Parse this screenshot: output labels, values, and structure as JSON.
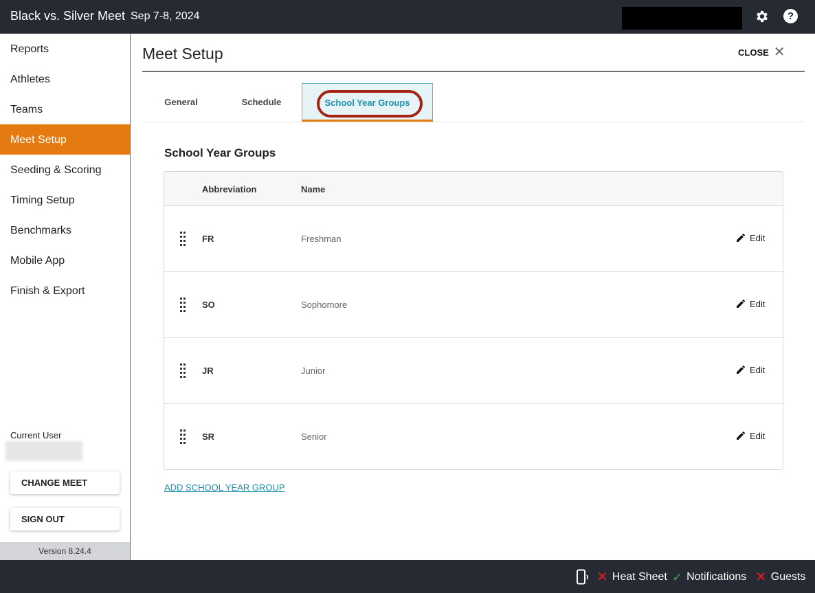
{
  "header": {
    "app_title": "Black vs. Silver Meet",
    "date": "Sep 7-8, 2024",
    "settings_icon": "gear-icon",
    "help_icon": "help-icon",
    "help_glyph": "?"
  },
  "sidebar": {
    "items": [
      {
        "label": "Reports",
        "active": false
      },
      {
        "label": "Athletes",
        "active": false
      },
      {
        "label": "Teams",
        "active": false
      },
      {
        "label": "Meet Setup",
        "active": true
      },
      {
        "label": "Seeding & Scoring",
        "active": false
      },
      {
        "label": "Timing Setup",
        "active": false
      },
      {
        "label": "Benchmarks",
        "active": false
      },
      {
        "label": "Mobile App",
        "active": false
      },
      {
        "label": "Finish & Export",
        "active": false
      }
    ],
    "current_user_label": "Current User",
    "change_meet_label": "CHANGE MEET",
    "sign_out_label": "SIGN OUT",
    "version": "Version 8.24.4"
  },
  "main": {
    "title": "Meet Setup",
    "close_label": "CLOSE",
    "tabs": [
      {
        "label": "General",
        "selected": false
      },
      {
        "label": "Schedule",
        "selected": false
      },
      {
        "label": "School Year Groups",
        "selected": true
      }
    ],
    "section_title": "School Year Groups",
    "table": {
      "headers": {
        "abbreviation": "Abbreviation",
        "name": "Name"
      },
      "rows": [
        {
          "abbreviation": "FR",
          "name": "Freshman",
          "action": "Edit"
        },
        {
          "abbreviation": "SO",
          "name": "Sophomore",
          "action": "Edit"
        },
        {
          "abbreviation": "JR",
          "name": "Junior",
          "action": "Edit"
        },
        {
          "abbreviation": "SR",
          "name": "Senior",
          "action": "Edit"
        }
      ]
    },
    "add_link": "ADD SCHOOL YEAR GROUP"
  },
  "footer": {
    "phone_icon": "mobile-phone-icon",
    "heat_sheet": "Heat Sheet",
    "notifications": "Notifications",
    "guests": "Guests"
  },
  "colors": {
    "topbar": "#262b33",
    "accent": "#e57b10",
    "link": "#1f8fa9",
    "highlight_ring": "#a52313",
    "status_off": "#e51c23",
    "status_on": "#3aa24a"
  }
}
